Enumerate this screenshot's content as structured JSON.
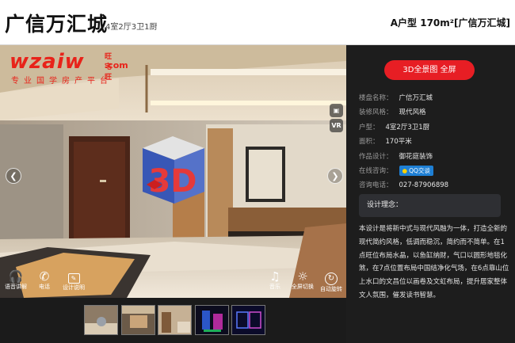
{
  "header": {
    "title": "广信万汇城",
    "subtitle": "4室2厅3卫1厨",
    "house_type": "A户型 170m²[广信万汇城]"
  },
  "viewer": {
    "logo": {
      "brand": "wzaiw",
      "brand_cn": "旺宅旺",
      "domain": ".com",
      "slogan": "专业国学房产平台"
    },
    "badge_3d": "3D",
    "side_buttons": {
      "vr": "VR"
    },
    "toolbar": [
      {
        "label": "语音讲解"
      },
      {
        "label": "电话"
      },
      {
        "label": "设计说明"
      },
      {
        "label": "音乐"
      },
      {
        "label": "全屏切换"
      },
      {
        "label": "自动旋转"
      }
    ]
  },
  "panel": {
    "button_label": "3D全景图 全屏",
    "info": [
      {
        "key": "楼盘名称：",
        "value": "广信万汇城"
      },
      {
        "key": "装修风格：",
        "value": "现代风格"
      },
      {
        "key": "户型：",
        "value": "4室2厅3卫1厨"
      },
      {
        "key": "面积：",
        "value": "170平米"
      },
      {
        "key": "作品设计：",
        "value": "御花庭装饰"
      },
      {
        "key": "在线咨询：",
        "value": "QQ交谈"
      },
      {
        "key": "咨询电话：",
        "value": "027-87906898"
      }
    ],
    "concept_title": "设计理念：",
    "concept_text": "本设计是将新中式与现代风融为一体，打造全新的现代简约风格，低调而稳沉，简约而不简单。在1点旺位布局水晶，以鱼缸纳财，气口以圆形地毯化煞，在7点位置布局中国结净化气场，在6点靠山位上水口的文昌位以画卷及文虹布局，提升居家整体文人氛围，催发读书智慧。"
  }
}
